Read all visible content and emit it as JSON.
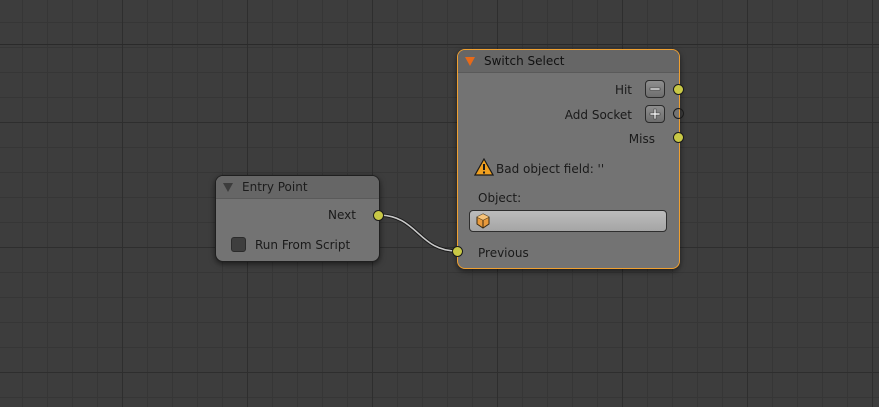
{
  "editor": {
    "background_color": "#3d3d3d",
    "wire_color": "#c8c8c8",
    "socket_color": "#c8c846",
    "selection_color": "#f0a030"
  },
  "entry_node": {
    "title": "Entry Point",
    "output_label": "Next",
    "checkbox_label": "Run From Script",
    "checkbox_checked": false
  },
  "switch_node": {
    "title": "Switch Select",
    "outputs": [
      {
        "label": "Hit",
        "button": "minus-icon"
      },
      {
        "label": "Add Socket",
        "button": "plus-icon"
      },
      {
        "label": "Miss"
      }
    ],
    "warning_text": "Bad object field: ''",
    "object_label": "Object:",
    "object_value": "",
    "input_label": "Previous"
  }
}
